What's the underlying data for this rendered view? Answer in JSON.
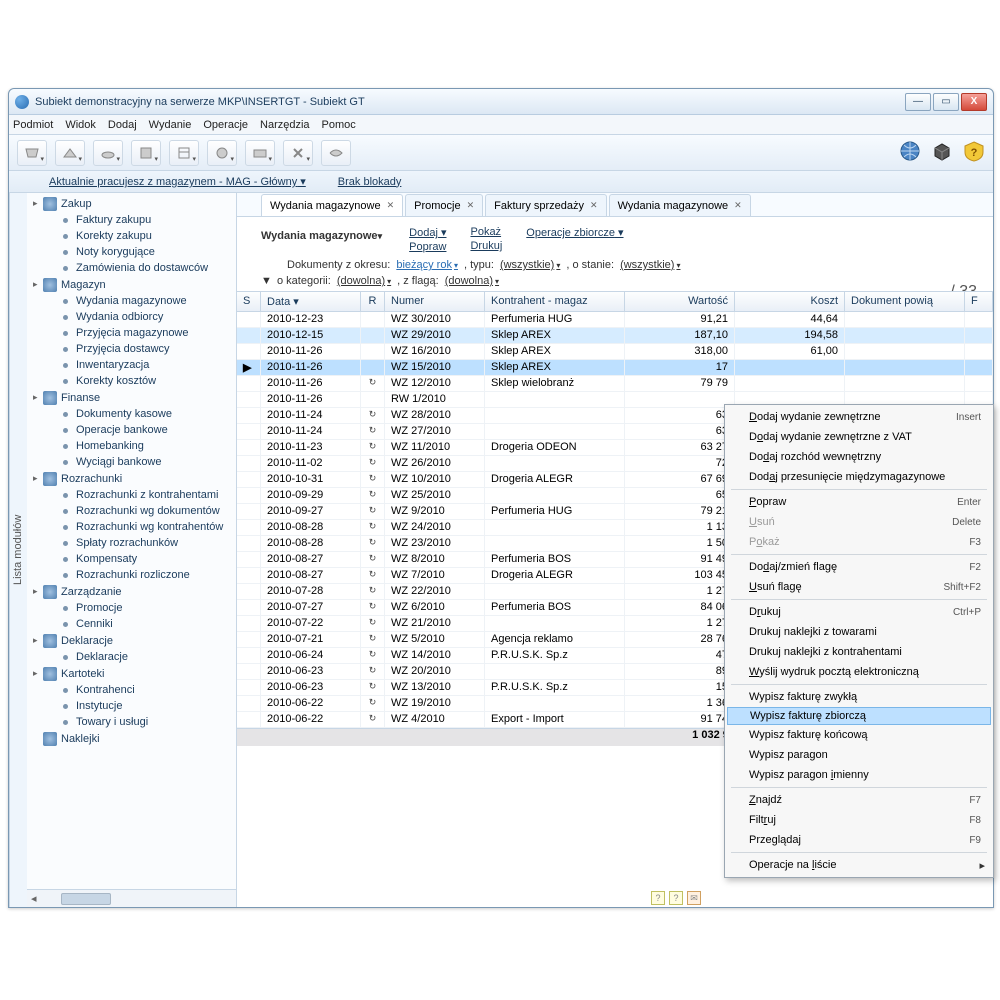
{
  "window": {
    "title": "Subiekt demonstracyjny na serwerze MKP\\INSERTGT - Subiekt GT"
  },
  "menubar": [
    "Podmiot",
    "Widok",
    "Dodaj",
    "Wydanie",
    "Operacje",
    "Narzędzia",
    "Pomoc"
  ],
  "statusline": {
    "warehouse": "Aktualnie pracujesz z magazynem - MAG - Główny",
    "lock": "Brak blokady"
  },
  "sidebar": {
    "groups": [
      {
        "label": "Zakup",
        "children": [
          "Faktury zakupu",
          "Korekty zakupu",
          "Noty korygujące",
          "Zamówienia do dostawców"
        ]
      },
      {
        "label": "Magazyn",
        "children": [
          "Wydania magazynowe",
          "Wydania odbiorcy",
          "Przyjęcia magazynowe",
          "Przyjęcia dostawcy",
          "Inwentaryzacja",
          "Korekty kosztów"
        ]
      },
      {
        "label": "Finanse",
        "children": [
          "Dokumenty kasowe",
          "Operacje bankowe",
          "Homebanking",
          "Wyciągi bankowe"
        ]
      },
      {
        "label": "Rozrachunki",
        "children": [
          "Rozrachunki z kontrahentami",
          "Rozrachunki wg dokumentów",
          "Rozrachunki wg kontrahentów",
          "Spłaty rozrachunków",
          "Kompensaty",
          "Rozrachunki rozliczone"
        ]
      },
      {
        "label": "Zarządzanie",
        "children": [
          "Promocje",
          "Cenniki"
        ]
      },
      {
        "label": "Deklaracje",
        "children": [
          "Deklaracje"
        ]
      },
      {
        "label": "Kartoteki",
        "children": [
          "Kontrahenci",
          "Instytucje",
          "Towary i usługi"
        ]
      },
      {
        "label": "Naklejki",
        "children": []
      }
    ],
    "tab_label": "Lista modułów"
  },
  "tabs": [
    {
      "label": "Wydania magazynowe",
      "active": true,
      "closable": true
    },
    {
      "label": "Promocje",
      "active": false,
      "closable": true
    },
    {
      "label": "Faktury sprzedaży",
      "active": false,
      "closable": true
    },
    {
      "label": "Wydania magazynowe",
      "active": false,
      "closable": true
    }
  ],
  "document": {
    "title": "Wydania magazynowe",
    "commands": {
      "dodaj": "Dodaj",
      "popraw": "Popraw",
      "pokaz": "Pokaż",
      "drukuj": "Drukuj",
      "zbiorcze": "Operacje zbiorcze"
    },
    "filters_text": {
      "documents_from": "Dokumenty z okresu:",
      "period": "bieżący rok",
      "typu": ", typu:",
      "typ_val": "(wszystkie)",
      "stanie": ", o stanie:",
      "stan_val": "(wszystkie)",
      "kategorii": "o kategorii:",
      "kat_val": "(dowolna)",
      "flaga": ", z flagą:",
      "flag_val": "(dowolna)"
    },
    "count": "/ 33"
  },
  "grid": {
    "columns": [
      "S",
      "Data",
      "R",
      "Numer",
      "Kontrahent - magaz",
      "Wartość",
      "Koszt",
      "Dokument powią",
      "F"
    ],
    "rows": [
      {
        "date": "2010-12-23",
        "r": "",
        "num": "WZ 30/2010",
        "kon": "Perfumeria HUG",
        "war": "91,21",
        "kos": "44,64",
        "sel": 0
      },
      {
        "date": "2010-12-15",
        "r": "",
        "num": "WZ 29/2010",
        "kon": "Sklep AREX",
        "war": "187,10",
        "kos": "194,58",
        "sel": 2
      },
      {
        "date": "2010-11-26",
        "r": "",
        "num": "WZ 16/2010",
        "kon": "Sklep AREX",
        "war": "318,00",
        "kos": "61,00",
        "sel": 0
      },
      {
        "date": "2010-11-26",
        "r": "",
        "num": "WZ 15/2010",
        "kon": "Sklep AREX",
        "war": "17",
        "kos": "",
        "sel": 1,
        "arrow": true
      },
      {
        "date": "2010-11-26",
        "r": "↻",
        "num": "WZ 12/2010",
        "kon": "Sklep wielobranż",
        "war": "79 79",
        "kos": "",
        "sel": 0
      },
      {
        "date": "2010-11-26",
        "r": "",
        "num": "RW 1/2010",
        "kon": "",
        "war": "",
        "kos": "",
        "sel": 0
      },
      {
        "date": "2010-11-24",
        "r": "↻",
        "num": "WZ 28/2010",
        "kon": "",
        "war": "63",
        "kos": "",
        "sel": 0
      },
      {
        "date": "2010-11-24",
        "r": "↻",
        "num": "WZ 27/2010",
        "kon": "",
        "war": "63",
        "kos": "",
        "sel": 0
      },
      {
        "date": "2010-11-23",
        "r": "↻",
        "num": "WZ 11/2010",
        "kon": "Drogeria ODEON",
        "war": "63 27",
        "kos": "",
        "sel": 0
      },
      {
        "date": "2010-11-02",
        "r": "↻",
        "num": "WZ 26/2010",
        "kon": "",
        "war": "72",
        "kos": "",
        "sel": 0
      },
      {
        "date": "2010-10-31",
        "r": "↻",
        "num": "WZ 10/2010",
        "kon": "Drogeria ALEGR",
        "war": "67 69",
        "kos": "",
        "sel": 0
      },
      {
        "date": "2010-09-29",
        "r": "↻",
        "num": "WZ 25/2010",
        "kon": "",
        "war": "65",
        "kos": "",
        "sel": 0
      },
      {
        "date": "2010-09-27",
        "r": "↻",
        "num": "WZ 9/2010",
        "kon": "Perfumeria HUG",
        "war": "79 21",
        "kos": "",
        "sel": 0
      },
      {
        "date": "2010-08-28",
        "r": "↻",
        "num": "WZ 24/2010",
        "kon": "",
        "war": "1 13",
        "kos": "",
        "sel": 0
      },
      {
        "date": "2010-08-28",
        "r": "↻",
        "num": "WZ 23/2010",
        "kon": "",
        "war": "1 50",
        "kos": "",
        "sel": 0
      },
      {
        "date": "2010-08-27",
        "r": "↻",
        "num": "WZ 8/2010",
        "kon": "Perfumeria BOS",
        "war": "91 49",
        "kos": "",
        "sel": 0
      },
      {
        "date": "2010-08-27",
        "r": "↻",
        "num": "WZ 7/2010",
        "kon": "Drogeria ALEGR",
        "war": "103 45",
        "kos": "",
        "sel": 0
      },
      {
        "date": "2010-07-28",
        "r": "↻",
        "num": "WZ 22/2010",
        "kon": "",
        "war": "1 27",
        "kos": "",
        "sel": 0
      },
      {
        "date": "2010-07-27",
        "r": "↻",
        "num": "WZ 6/2010",
        "kon": "Perfumeria BOS",
        "war": "84 06",
        "kos": "",
        "sel": 0
      },
      {
        "date": "2010-07-22",
        "r": "↻",
        "num": "WZ 21/2010",
        "kon": "",
        "war": "1 27",
        "kos": "",
        "sel": 0
      },
      {
        "date": "2010-07-21",
        "r": "↻",
        "num": "WZ 5/2010",
        "kon": "Agencja reklamo",
        "war": "28 76",
        "kos": "",
        "sel": 0
      },
      {
        "date": "2010-06-24",
        "r": "↻",
        "num": "WZ 14/2010",
        "kon": "P.R.U.S.K. Sp.z",
        "war": "47",
        "kos": "",
        "sel": 0
      },
      {
        "date": "2010-06-23",
        "r": "↻",
        "num": "WZ 20/2010",
        "kon": "",
        "war": "89",
        "kos": "",
        "sel": 0
      },
      {
        "date": "2010-06-23",
        "r": "↻",
        "num": "WZ 13/2010",
        "kon": "P.R.U.S.K. Sp.z",
        "war": "15",
        "kos": "",
        "sel": 0
      },
      {
        "date": "2010-06-22",
        "r": "↻",
        "num": "WZ 19/2010",
        "kon": "",
        "war": "1 36",
        "kos": "",
        "sel": 0
      },
      {
        "date": "2010-06-22",
        "r": "↻",
        "num": "WZ 4/2010",
        "kon": "Export - Import",
        "war": "91 74",
        "kos": "",
        "sel": 0
      }
    ],
    "total": "1 032 93"
  },
  "context_menu": {
    "items": [
      {
        "label": "Dodaj wydanie zewnętrzne",
        "u": 0,
        "short": "Insert"
      },
      {
        "label": "Dodaj wydanie zewnętrzne z VAT",
        "u": 1
      },
      {
        "label": "Dodaj rozchód wewnętrzny",
        "u": 2
      },
      {
        "label": "Dodaj przesunięcie międzymagazynowe",
        "u": 3
      },
      {
        "sep": true
      },
      {
        "label": "Popraw",
        "u": 0,
        "short": "Enter"
      },
      {
        "label": "Usuń",
        "u": 0,
        "short": "Delete",
        "dis": true
      },
      {
        "label": "Pokaż",
        "u": 1,
        "short": "F3",
        "dis": true
      },
      {
        "sep": true
      },
      {
        "label": "Dodaj/zmień flagę",
        "u": 2,
        "short": "F2"
      },
      {
        "label": "Usuń flagę",
        "u": 0,
        "short": "Shift+F2"
      },
      {
        "sep": true
      },
      {
        "label": "Drukuj",
        "u": 1,
        "short": "Ctrl+P"
      },
      {
        "label": "Drukuj naklejki z towarami"
      },
      {
        "label": "Drukuj naklejki z kontrahentami"
      },
      {
        "label": "Wyślij wydruk pocztą elektroniczną",
        "u": 0
      },
      {
        "sep": true
      },
      {
        "label": "Wypisz fakturę zwykłą"
      },
      {
        "label": "Wypisz fakturę zbiorczą",
        "hi": true
      },
      {
        "label": "Wypisz fakturę końcową"
      },
      {
        "label": "Wypisz paragon"
      },
      {
        "label": "Wypisz paragon imienny",
        "u": 15
      },
      {
        "sep": true
      },
      {
        "label": "Znajdź",
        "u": 0,
        "short": "F7"
      },
      {
        "label": "Filtruj",
        "u": 4,
        "short": "F8"
      },
      {
        "label": "Przeglądaj",
        "short": "F9"
      },
      {
        "sep": true
      },
      {
        "label": "Operacje na liście",
        "u": 12,
        "sub": true
      }
    ]
  }
}
